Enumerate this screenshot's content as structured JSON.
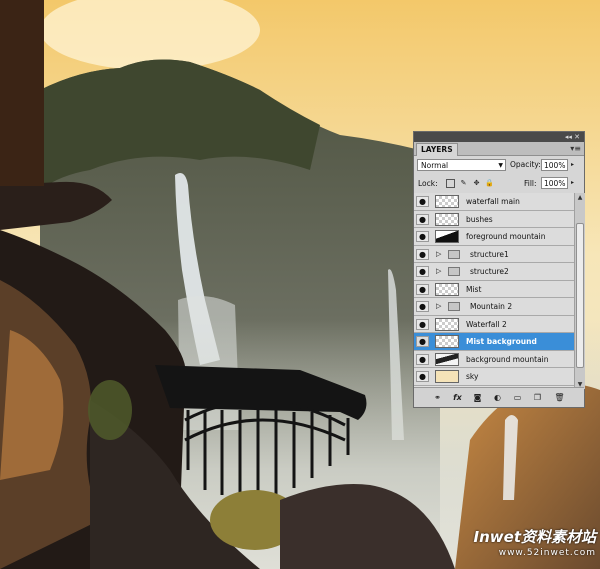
{
  "panel": {
    "tab_label": "LAYERS",
    "menu_icon": "panel-menu-icon",
    "blend_mode": "Normal",
    "opacity_label": "Opacity:",
    "opacity_value": "100%",
    "lock_label": "Lock:",
    "fill_label": "Fill:",
    "fill_value": "100%"
  },
  "layers": [
    {
      "name": "waterfall main",
      "kind": "layer",
      "thumb": "transparent",
      "visible": true,
      "selected": false
    },
    {
      "name": "bushes",
      "kind": "layer",
      "thumb": "transparent",
      "visible": true,
      "selected": false
    },
    {
      "name": "foreground mountain",
      "kind": "layer",
      "thumb": "fg",
      "visible": true,
      "selected": false
    },
    {
      "name": "structure1",
      "kind": "group",
      "visible": true,
      "selected": false
    },
    {
      "name": "structure2",
      "kind": "group",
      "visible": true,
      "selected": false
    },
    {
      "name": "Mist",
      "kind": "layer",
      "thumb": "transparent",
      "visible": true,
      "selected": false
    },
    {
      "name": "Mountain 2",
      "kind": "group",
      "visible": true,
      "selected": false
    },
    {
      "name": "Waterfall 2",
      "kind": "layer",
      "thumb": "transparent",
      "visible": true,
      "selected": false
    },
    {
      "name": "Mist background",
      "kind": "layer",
      "thumb": "transparent",
      "visible": true,
      "selected": true
    },
    {
      "name": "background mountain",
      "kind": "layer",
      "thumb": "bgm",
      "visible": true,
      "selected": false
    },
    {
      "name": "sky",
      "kind": "layer",
      "thumb": "sky",
      "visible": true,
      "selected": false
    }
  ],
  "watermark": {
    "main": "Inwet资料素材站",
    "url": "www.52inwet.com"
  },
  "colors": {
    "selected_row": "#3a8ed8",
    "panel_bg": "#d6d6d6",
    "sky_warm": "#f4d998",
    "left_bar": "#3b2415"
  }
}
